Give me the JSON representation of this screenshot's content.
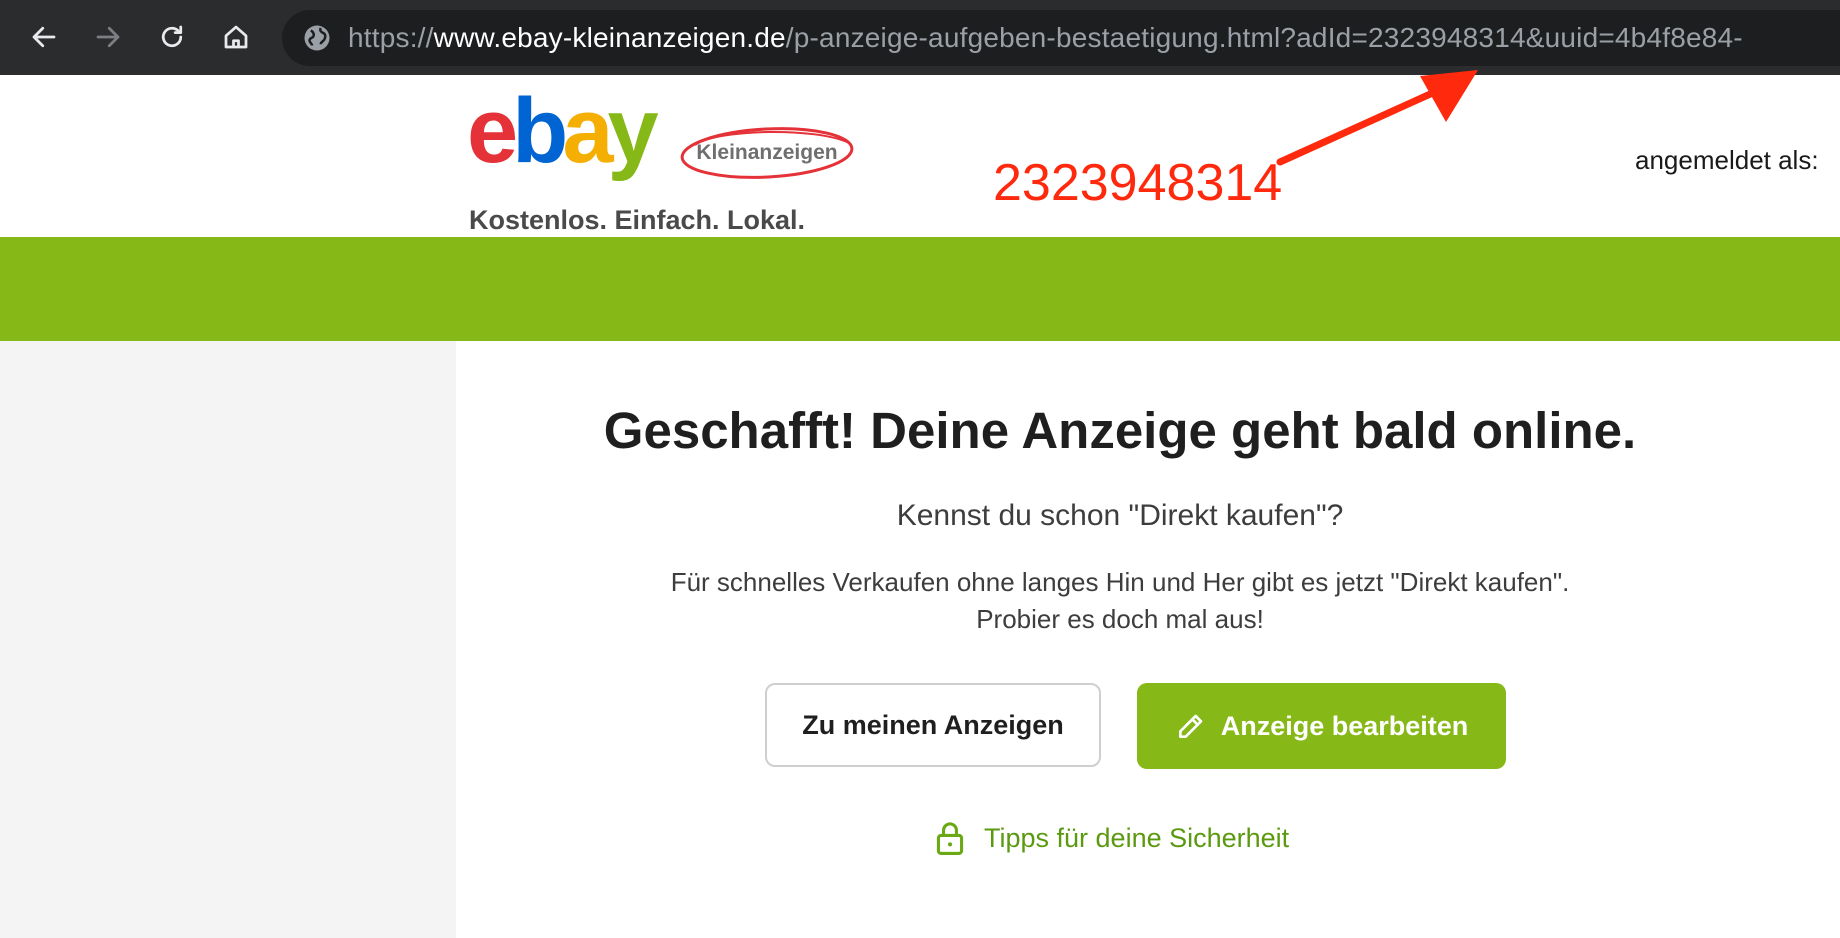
{
  "browser": {
    "url_scheme": "https://",
    "url_host": "www.ebay-kleinanzeigen.de",
    "url_path": "/p-anzeige-aufgeben-bestaetigung.html?adId=2323948314&uuid=4b4f8e84-"
  },
  "header": {
    "logo": {
      "letters": [
        "e",
        "b",
        "a",
        "y"
      ],
      "badge": "Kleinanzeigen"
    },
    "tagline": "Kostenlos. Einfach. Lokal.",
    "login_label": "angemeldet als:"
  },
  "annotation": {
    "number": "2323948314",
    "color": "#ff2a0e"
  },
  "main": {
    "title": "Geschafft! Deine Anzeige geht bald online.",
    "subtitle": "Kennst du schon \"Direkt kaufen\"?",
    "description_lines": [
      "Für schnelles Verkaufen ohne langes Hin und Her gibt es jetzt \"Direkt kaufen\".",
      "Probier es doch mal aus!"
    ],
    "buttons": {
      "my_ads": "Zu meinen Anzeigen",
      "edit_ad": "Anzeige bearbeiten"
    },
    "safety_link": "Tipps für deine Sicherheit"
  },
  "colors": {
    "brand_green": "#86b817",
    "link_green": "#5b9a10",
    "browser_bg": "#2b2c2e"
  },
  "icons": {
    "back": "arrow-left-icon",
    "forward": "arrow-right-icon",
    "reload": "reload-icon",
    "home": "home-icon",
    "site_info": "globe-icon",
    "edit": "pencil-icon",
    "safety": "lock-icon"
  }
}
